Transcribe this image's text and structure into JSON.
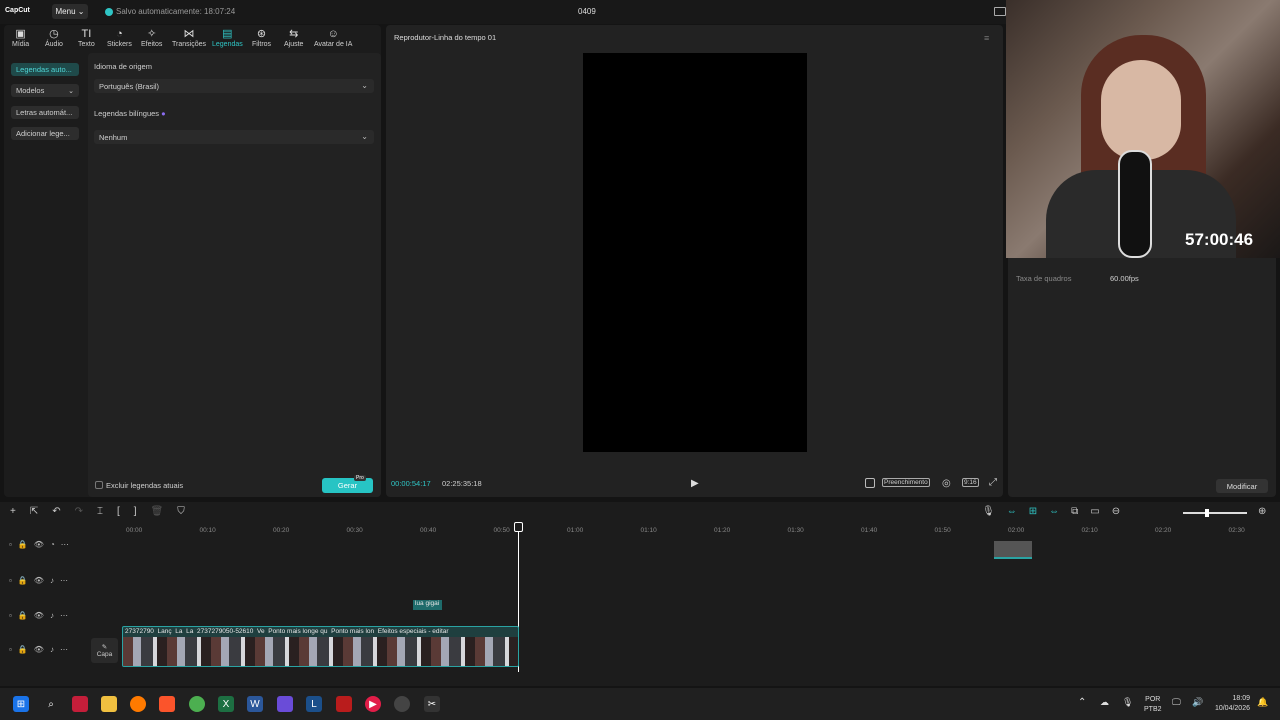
{
  "topbar": {
    "logo": "CapCut",
    "menu": "Menu",
    "saved": "Salvo automaticamente: 18:07:24",
    "project": "0409"
  },
  "toolbar": {
    "items": [
      {
        "label": "Mídia",
        "icon": "media-icon"
      },
      {
        "label": "Áudio",
        "icon": "audio-icon"
      },
      {
        "label": "Texto",
        "icon": "text-icon"
      },
      {
        "label": "Stickers",
        "icon": "sticker-icon"
      },
      {
        "label": "Efeitos",
        "icon": "effects-icon"
      },
      {
        "label": "Transições",
        "icon": "transition-icon"
      },
      {
        "label": "Legendas",
        "icon": "captions-icon"
      },
      {
        "label": "Filtros",
        "icon": "filter-icon"
      },
      {
        "label": "Ajuste",
        "icon": "adjust-icon"
      },
      {
        "label": "Avatar de IA",
        "icon": "avatar-icon"
      }
    ]
  },
  "sidebar": {
    "items": [
      {
        "label": "Legendas auto..."
      },
      {
        "label": "Modelos"
      },
      {
        "label": "Letras automát..."
      },
      {
        "label": "Adicionar lege..."
      }
    ]
  },
  "captions": {
    "source_label": "Idioma de origem",
    "source_value": "Português (Brasil)",
    "bilingual_label": "Legendas bilíngues",
    "bilingual_value": "Nenhum",
    "exclude_label": "Excluir legendas atuais",
    "generate": "Gerar",
    "pro_badge": "Pro"
  },
  "player": {
    "title": "Reprodutor-Linha do tempo 01",
    "current": "00:00:54:17",
    "total": "02:25:35:18",
    "fill": "Preenchimento",
    "ratio": "9:16"
  },
  "details": {
    "fps_label": "Taxa de quadros",
    "fps_value": "60.00fps",
    "modify": "Modificar"
  },
  "stream": {
    "timer": "57:00:46"
  },
  "timeline": {
    "ruler": [
      "00:00",
      "00:10",
      "00:20",
      "00:30",
      "00:40",
      "00:50",
      "01:00",
      "01:10",
      "01:20",
      "01:30",
      "01:40",
      "01:50",
      "02:00",
      "02:10",
      "02:20",
      "02:30"
    ],
    "cover": "Capa",
    "text_clip": "lua gigai",
    "clips": [
      "27372790",
      "Lanç",
      "La",
      "La",
      "2737279050-52610",
      "Ve",
      "Ponto mais longe qu",
      "Ponto mais lon",
      "Efeitos especiais - editar"
    ]
  },
  "taskbar": {
    "lang": "POR",
    "layout": "PTB2",
    "time": "18:09",
    "date": "10/04/2026"
  }
}
